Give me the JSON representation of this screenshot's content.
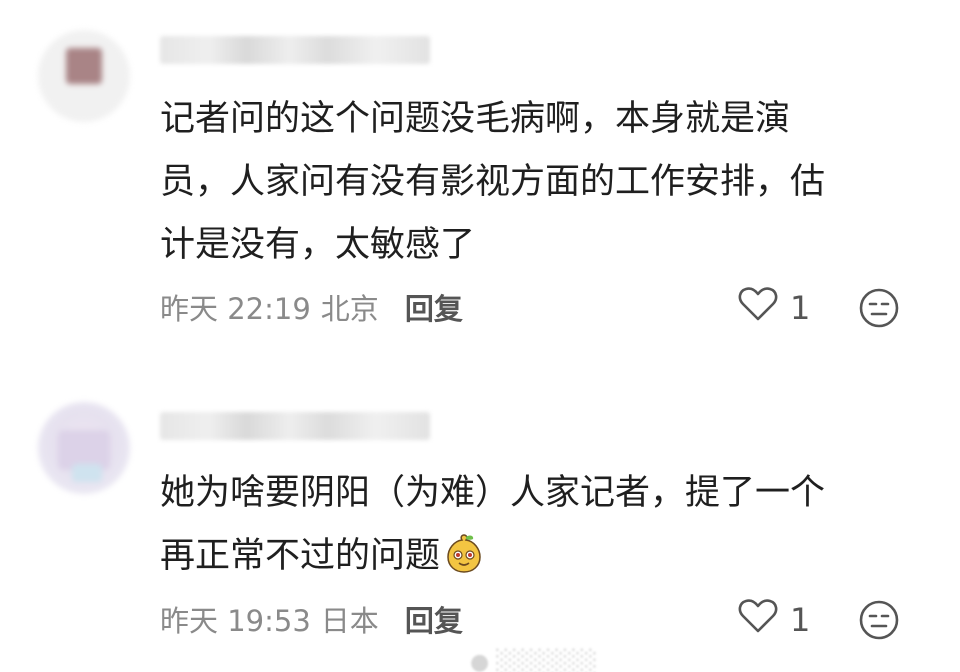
{
  "comments": [
    {
      "text_lines": [
        "记者问的这个问题没毛病啊，本身就是演",
        "员，人家问有没有影视方面的工作安排，估",
        "计是没有，太敏感了"
      ],
      "time": "昨天 22:19",
      "location": "北京",
      "reply_label": "回复",
      "like_count": "1"
    },
    {
      "text_lines": [
        "她为啥要阴阳（为难）人家记者，提了一个",
        "再正常不过的问题"
      ],
      "time": "昨天 19:53",
      "location": "日本",
      "reply_label": "回复",
      "like_count": "1"
    }
  ],
  "icons": {
    "like": "heart-outline-icon",
    "emoji_reaction": "expressionless-face-icon",
    "inline_emoji": "gourd-emoji"
  },
  "colors": {
    "text": "#1f1f1f",
    "meta": "#8a8a8a",
    "icon": "#555555"
  }
}
